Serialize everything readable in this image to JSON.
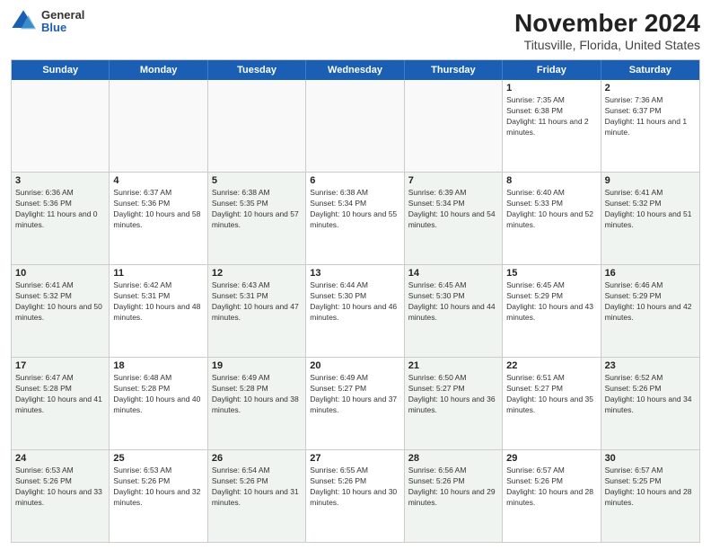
{
  "header": {
    "logo": {
      "general": "General",
      "blue": "Blue"
    },
    "title": "November 2024",
    "subtitle": "Titusville, Florida, United States"
  },
  "days_of_week": [
    "Sunday",
    "Monday",
    "Tuesday",
    "Wednesday",
    "Thursday",
    "Friday",
    "Saturday"
  ],
  "weeks": [
    [
      {
        "day": "",
        "empty": true
      },
      {
        "day": "",
        "empty": true
      },
      {
        "day": "",
        "empty": true
      },
      {
        "day": "",
        "empty": true
      },
      {
        "day": "",
        "empty": true
      },
      {
        "day": "1",
        "sunrise": "7:35 AM",
        "sunset": "6:38 PM",
        "daylight": "11 hours and 2 minutes."
      },
      {
        "day": "2",
        "sunrise": "7:36 AM",
        "sunset": "6:37 PM",
        "daylight": "11 hours and 1 minute."
      }
    ],
    [
      {
        "day": "3",
        "sunrise": "6:36 AM",
        "sunset": "5:36 PM",
        "daylight": "11 hours and 0 minutes.",
        "shaded": true
      },
      {
        "day": "4",
        "sunrise": "6:37 AM",
        "sunset": "5:36 PM",
        "daylight": "10 hours and 58 minutes."
      },
      {
        "day": "5",
        "sunrise": "6:38 AM",
        "sunset": "5:35 PM",
        "daylight": "10 hours and 57 minutes.",
        "shaded": true
      },
      {
        "day": "6",
        "sunrise": "6:38 AM",
        "sunset": "5:34 PM",
        "daylight": "10 hours and 55 minutes."
      },
      {
        "day": "7",
        "sunrise": "6:39 AM",
        "sunset": "5:34 PM",
        "daylight": "10 hours and 54 minutes.",
        "shaded": true
      },
      {
        "day": "8",
        "sunrise": "6:40 AM",
        "sunset": "5:33 PM",
        "daylight": "10 hours and 52 minutes."
      },
      {
        "day": "9",
        "sunrise": "6:41 AM",
        "sunset": "5:32 PM",
        "daylight": "10 hours and 51 minutes.",
        "shaded": true
      }
    ],
    [
      {
        "day": "10",
        "sunrise": "6:41 AM",
        "sunset": "5:32 PM",
        "daylight": "10 hours and 50 minutes.",
        "shaded": true
      },
      {
        "day": "11",
        "sunrise": "6:42 AM",
        "sunset": "5:31 PM",
        "daylight": "10 hours and 48 minutes."
      },
      {
        "day": "12",
        "sunrise": "6:43 AM",
        "sunset": "5:31 PM",
        "daylight": "10 hours and 47 minutes.",
        "shaded": true
      },
      {
        "day": "13",
        "sunrise": "6:44 AM",
        "sunset": "5:30 PM",
        "daylight": "10 hours and 46 minutes."
      },
      {
        "day": "14",
        "sunrise": "6:45 AM",
        "sunset": "5:30 PM",
        "daylight": "10 hours and 44 minutes.",
        "shaded": true
      },
      {
        "day": "15",
        "sunrise": "6:45 AM",
        "sunset": "5:29 PM",
        "daylight": "10 hours and 43 minutes."
      },
      {
        "day": "16",
        "sunrise": "6:46 AM",
        "sunset": "5:29 PM",
        "daylight": "10 hours and 42 minutes.",
        "shaded": true
      }
    ],
    [
      {
        "day": "17",
        "sunrise": "6:47 AM",
        "sunset": "5:28 PM",
        "daylight": "10 hours and 41 minutes.",
        "shaded": true
      },
      {
        "day": "18",
        "sunrise": "6:48 AM",
        "sunset": "5:28 PM",
        "daylight": "10 hours and 40 minutes."
      },
      {
        "day": "19",
        "sunrise": "6:49 AM",
        "sunset": "5:28 PM",
        "daylight": "10 hours and 38 minutes.",
        "shaded": true
      },
      {
        "day": "20",
        "sunrise": "6:49 AM",
        "sunset": "5:27 PM",
        "daylight": "10 hours and 37 minutes."
      },
      {
        "day": "21",
        "sunrise": "6:50 AM",
        "sunset": "5:27 PM",
        "daylight": "10 hours and 36 minutes.",
        "shaded": true
      },
      {
        "day": "22",
        "sunrise": "6:51 AM",
        "sunset": "5:27 PM",
        "daylight": "10 hours and 35 minutes."
      },
      {
        "day": "23",
        "sunrise": "6:52 AM",
        "sunset": "5:26 PM",
        "daylight": "10 hours and 34 minutes.",
        "shaded": true
      }
    ],
    [
      {
        "day": "24",
        "sunrise": "6:53 AM",
        "sunset": "5:26 PM",
        "daylight": "10 hours and 33 minutes.",
        "shaded": true
      },
      {
        "day": "25",
        "sunrise": "6:53 AM",
        "sunset": "5:26 PM",
        "daylight": "10 hours and 32 minutes."
      },
      {
        "day": "26",
        "sunrise": "6:54 AM",
        "sunset": "5:26 PM",
        "daylight": "10 hours and 31 minutes.",
        "shaded": true
      },
      {
        "day": "27",
        "sunrise": "6:55 AM",
        "sunset": "5:26 PM",
        "daylight": "10 hours and 30 minutes."
      },
      {
        "day": "28",
        "sunrise": "6:56 AM",
        "sunset": "5:26 PM",
        "daylight": "10 hours and 29 minutes.",
        "shaded": true
      },
      {
        "day": "29",
        "sunrise": "6:57 AM",
        "sunset": "5:26 PM",
        "daylight": "10 hours and 28 minutes."
      },
      {
        "day": "30",
        "sunrise": "6:57 AM",
        "sunset": "5:25 PM",
        "daylight": "10 hours and 28 minutes.",
        "shaded": true
      }
    ]
  ]
}
